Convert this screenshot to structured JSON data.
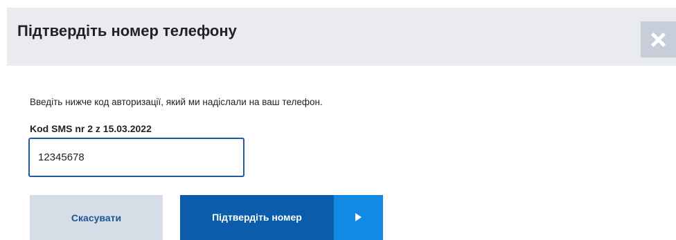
{
  "dialog": {
    "title": "Підтвердіть номер телефону",
    "close_icon": "close-icon"
  },
  "form": {
    "intro": "Введіть нижче код авторизації, який ми надіслали на ваш телефон.",
    "sms_label": "Kod SMS nr 2 z 15.03.2022",
    "code_value": "12345678"
  },
  "buttons": {
    "cancel_label": "Скасувати",
    "confirm_label": "Підтвердіть номер",
    "confirm_icon": "play-icon"
  },
  "colors": {
    "header_bg": "#e9ebee",
    "close_bg": "#c7ced9",
    "input_border": "#1e5aa8",
    "cancel_bg": "#d6dde7",
    "cancel_text": "#1d5497",
    "confirm_bg": "#0b5cab",
    "confirm_arrow_bg": "#1289e2"
  }
}
